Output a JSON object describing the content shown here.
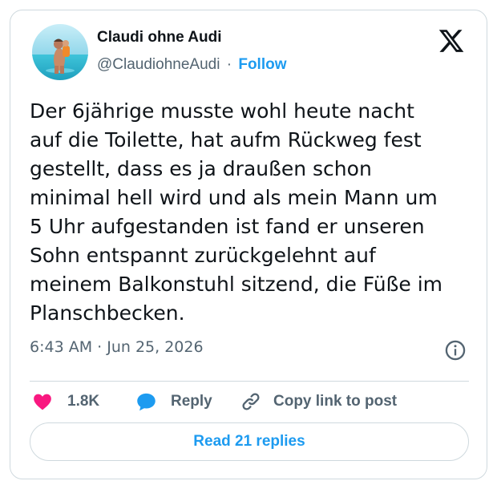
{
  "author": {
    "display_name": "Claudi ohne Audi",
    "handle": "@ClaudiohneAudi",
    "separator": "·",
    "follow_label": "Follow",
    "avatar": "beach-photo-avatar"
  },
  "header": {
    "logo_icon": "x-logo-icon"
  },
  "tweet": {
    "text": "Der 6jährige musste wohl heute nacht\nauf die Toilette, hat aufm Rückweg fest\ngestellt, dass es ja draußen schon\nminimal hell wird und als mein Mann um\n5 Uhr aufgestanden ist fand er unseren\nSohn entspannt zurückgelehnt auf\nmeinem Balkonstuhl sitzend, die Füße im\nPlanschbecken.",
    "timestamp": "6:43 AM · Jun 25, 2026",
    "info_icon": "info-icon"
  },
  "actions": {
    "like_count": "1.8K",
    "like_icon": "heart-icon",
    "reply_label": "Reply",
    "reply_icon": "speech-bubble-icon",
    "copy_label": "Copy link to post",
    "copy_icon": "link-icon",
    "read_replies_label": "Read 21 replies"
  },
  "colors": {
    "accent": "#1d9bf0",
    "like": "#f91880",
    "text_primary": "#0f1419",
    "text_secondary": "#536471",
    "border": "#cfd9de"
  }
}
